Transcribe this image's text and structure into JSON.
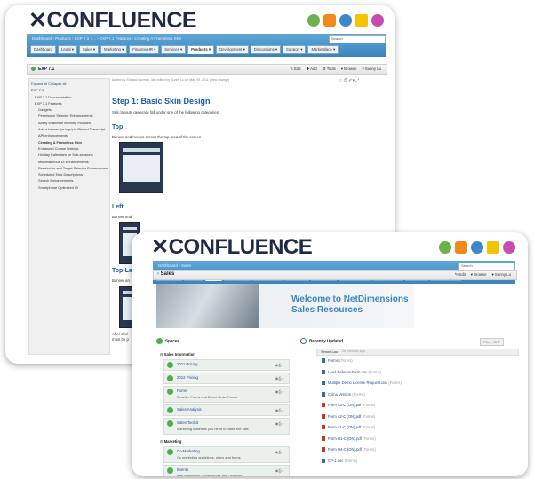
{
  "brand": {
    "logo": "CONFLUENCE"
  },
  "back_window": {
    "breadcrumb": "Dashboard › Products › EXP 7.1 › ... › EXP 7.1 Features › Creating A Frameless Skin",
    "search_placeholder": "Search",
    "tabs": [
      "Dashboard",
      "Legal ▾",
      "Sales ▾",
      "Marketing ▾",
      "Finance/HR ▾",
      "Services ▾",
      "Products ▾",
      "Development ▾",
      "Discussions ▾",
      "Support ▾",
      "Marketplace ▾"
    ],
    "active_tab": "Products",
    "space_title": "EXP 7.1",
    "actions": {
      "edit": "Edit",
      "add": "Add",
      "tools": "Tools",
      "browse": "Browse",
      "user": "Sunny Lu"
    },
    "tree": {
      "toggle": "Expand all  Collapse all",
      "items": [
        "EXP 7.1",
        "EXP 7.1 Documentation",
        "EXP 7.1 Features",
        "Gadgets",
        "Permission Selector Enhancements",
        "Ability to archive learning modules",
        "Add a banner (or logo) to Printed Transcript",
        "API enhancements",
        "Creating A Frameless Skin",
        "Enhanced Course Listings",
        "Holiday Calendars on Sub-sessions",
        "Miscellaneous UI Enhancements",
        "Permission and Target Selector Enhancements",
        "Scheduled Task Descriptions",
        "Search Enhancements",
        "Smartphone Optimized UI"
      ]
    },
    "meta": "Added by Shazad Qureshi, last edited by Sunny Lu on May 09, 2011 (view change)",
    "heading": "Step 1: Basic Skin Design",
    "intro": "Skin layouts generally fall under one of the following categories.",
    "sections": [
      {
        "title": "Top",
        "text": "Banner and menus across the top area of the screen"
      },
      {
        "title": "Left",
        "text": "Banner and"
      },
      {
        "title": "Top-Le",
        "text": "Banner an"
      }
    ],
    "footer_text": [
      "After deci",
      "must be p"
    ]
  },
  "front_window": {
    "breadcrumb": "Dashboard › Sales",
    "search_placeholder": "Search",
    "tabs": [
      "Dashboard",
      "Legal ▾",
      "Sales",
      "Marketing ▾",
      "Finance/HR ▾",
      "Services ▾",
      "Products ▾",
      "Development ▾",
      "Discussions ▾",
      "Support ▾",
      "Marketplace ▾"
    ],
    "active_tab": "Sales",
    "space_title": "Sales",
    "actions": {
      "edit": "Edit",
      "browse": "Browse",
      "user": "Sunny Lu"
    },
    "welcome": [
      "Welcome to NetDimensions",
      "Sales Resources"
    ],
    "spaces_label": "Spaces",
    "recently_updated_label": "Recently Updated",
    "filter": "Filter: OFF",
    "sales_info_label": "Sales Information",
    "sales_items": [
      {
        "name": "2011 Pricing",
        "desc": ""
      },
      {
        "name": "2012 Pricing",
        "desc": ""
      },
      {
        "name": "Forms",
        "desc": "Reseller Forms and Direct Order Forms"
      },
      {
        "name": "Sales Analysis",
        "desc": ""
      },
      {
        "name": "Sales Toolkit",
        "desc": "Marketing materials you need to make the sale"
      }
    ],
    "marketing_label": "Marketing",
    "marketing_items": [
      {
        "name": "Co-Marketing",
        "desc": "Co marketing guidelines, plans and forms"
      },
      {
        "name": "Events",
        "desc": "NetDimensions Conferences and Learning"
      }
    ],
    "ru_user": "Simon Lau",
    "ru_time": "26 minutes ago",
    "ru_items": [
      {
        "name": "Forms",
        "space": "(Forms)"
      },
      {
        "name": "Lead Referral Form.doc",
        "space": "(Forms)"
      },
      {
        "name": "Multiple Demo License Request.doc",
        "space": "(Forms)"
      },
      {
        "name": "China Version",
        "space": "(Forms)"
      },
      {
        "name": "Form A3-C (ON).pdf",
        "space": "(Forms)"
      },
      {
        "name": "Form A2-C (ON).pdf",
        "space": "(Forms)"
      },
      {
        "name": "Form A1-C (ON).pdf",
        "space": "(Forms)"
      },
      {
        "name": "Form H1-C (ON).pdf",
        "space": "(Forms)"
      },
      {
        "name": "Form H4-C (ON).pdf",
        "space": "(Forms)"
      },
      {
        "name": "CP-1.doc",
        "space": "(Forms)"
      }
    ]
  },
  "colors": {
    "brand_navy": "#1f2b46",
    "nav_blue": "#4a92c9",
    "link_blue": "#1d4f8c",
    "heading_blue": "#1b5ea8",
    "accent_green": "#4caf50"
  }
}
